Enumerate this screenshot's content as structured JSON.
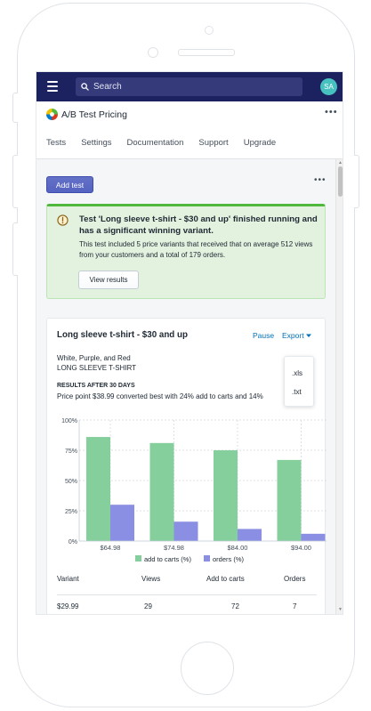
{
  "search": {
    "placeholder": "Search"
  },
  "user": {
    "initials": "SA"
  },
  "app": {
    "title": "A/B Test Pricing"
  },
  "nav": {
    "tabs": [
      "Tests",
      "Settings",
      "Documentation",
      "Support",
      "Upgrade"
    ]
  },
  "page": {
    "add_test_label": "Add test"
  },
  "banner": {
    "title": "Test 'Long sleeve t-shirt - $30 and up' finished running and has a significant winning variant.",
    "body": "This test included 5 price variants that received that on average 512 views from your customers and a total of 179 orders.",
    "button_label": "View results"
  },
  "card": {
    "title": "Long sleeve t-shirt - $30 and up",
    "pause_label": "Pause",
    "export_label": "Export",
    "export_options": [
      ".xls",
      ".txt"
    ],
    "variant_colors": "White, Purple, and Red",
    "variant_name": "LONG SLEEVE T-SHIRT",
    "results_heading": "RESULTS AFTER 30 DAYS",
    "results_summary": "Price point $38.99 converted best with 24% add to carts and 14%"
  },
  "chart_data": {
    "type": "bar",
    "categories": [
      "$64.98",
      "$74.98",
      "$84.00",
      "$94.00"
    ],
    "series": [
      {
        "name": "add to carts (%)",
        "values": [
          86,
          81,
          75,
          67
        ],
        "color": "#85cf9c"
      },
      {
        "name": "orders (%)",
        "values": [
          30,
          16,
          10,
          6
        ],
        "color": "#8a8fe3"
      }
    ],
    "ylim": [
      0,
      100
    ],
    "yticks": [
      "0%",
      "25%",
      "50%",
      "75%",
      "100%"
    ],
    "grid": true,
    "legend": "bottom"
  },
  "table": {
    "headers": [
      "Variant",
      "Views",
      "Add to carts",
      "Orders"
    ],
    "rows": [
      [
        "$29.99",
        "29",
        "72",
        "7"
      ]
    ]
  },
  "colors": {
    "topbar": "#1c2260",
    "primary": "#5c6ac4",
    "success_border": "#50b83c",
    "link": "#006fbb"
  }
}
